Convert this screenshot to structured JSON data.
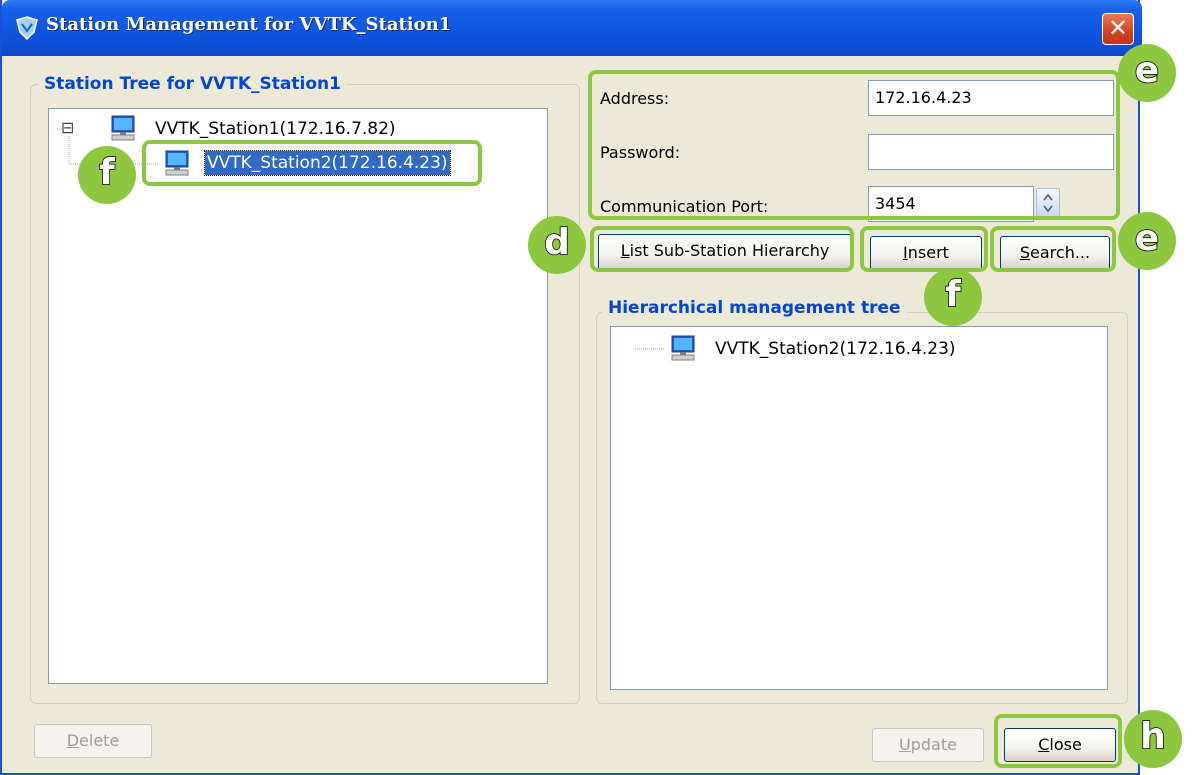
{
  "window": {
    "title": "Station Management for VVTK_Station1",
    "close_glyph": "✕"
  },
  "left_panel": {
    "group_title": "Station Tree for VVTK_Station1",
    "tree": {
      "expander": "⊟",
      "root": "VVTK_Station1(172.16.7.82)",
      "child": "VVTK_Station2(172.16.4.23)"
    },
    "delete_button": {
      "mnemonic": "D",
      "rest": "elete"
    }
  },
  "connection": {
    "address_label": "Address:",
    "address_value": "172.16.4.23",
    "password_label": "Password:",
    "password_value": "",
    "port_label": "Communication Port:",
    "port_value": "3454"
  },
  "buttons": {
    "list_hierarchy": {
      "mnemonic": "L",
      "rest": "ist Sub-Station Hierarchy"
    },
    "insert": {
      "mnemonic": "I",
      "rest": "nsert"
    },
    "search": {
      "mnemonic": "S",
      "rest": "earch..."
    },
    "update": {
      "mnemonic": "U",
      "rest": "pdate"
    },
    "close": {
      "mnemonic": "C",
      "rest": "lose"
    }
  },
  "hierarchy_panel": {
    "group_title": "Hierarchical management tree",
    "item": "VVTK_Station2(172.16.4.23)"
  },
  "annotations": {
    "e_top": "e",
    "f_left": "f",
    "d": "d",
    "e_search": "e",
    "f_insert": "f",
    "h": "h"
  },
  "colors": {
    "highlight_green": "#8dc63f",
    "title_blue": "#0f55e0",
    "group_title_blue": "#0046d5",
    "selection_blue": "#316ac5",
    "dialog_bg": "#ECE9D8"
  },
  "icons": {
    "title": "shield-logo-icon",
    "close": "close-icon",
    "station": "computer-icon",
    "spinner_up": "chevron-up-icon",
    "spinner_down": "chevron-down-icon",
    "collapse": "minus-box-icon"
  }
}
